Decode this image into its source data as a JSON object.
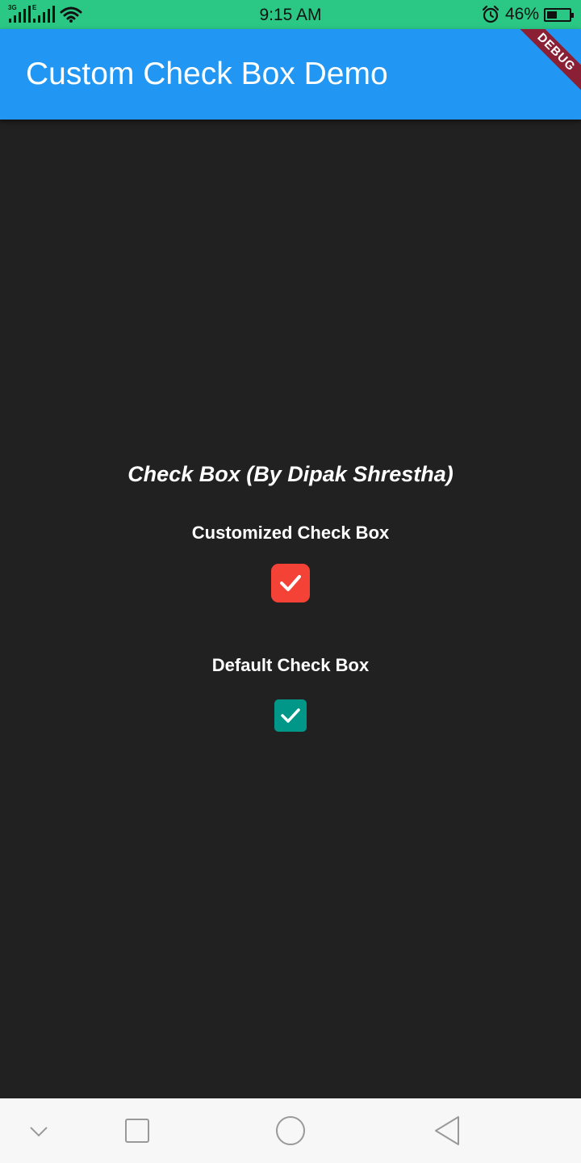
{
  "status_bar": {
    "network_1": "3G",
    "network_2": "E",
    "time": "9:15 AM",
    "battery_percent": "46%",
    "battery_level": 0.46,
    "icons": [
      "signal-icon",
      "wifi-icon",
      "alarm-icon",
      "battery-icon"
    ]
  },
  "app_bar": {
    "title": "Custom Check Box Demo",
    "debug_banner": "DEBUG",
    "color": "#2196f3"
  },
  "main": {
    "heading": "Check Box (By Dipak Shrestha)",
    "custom_checkbox": {
      "label": "Customized Check Box",
      "checked": true,
      "color": "#f44336"
    },
    "default_checkbox": {
      "label": "Default Check Box",
      "checked": true,
      "color": "#009688"
    }
  },
  "nav_bar": {
    "icons": [
      "chevron-down-icon",
      "recents-icon",
      "home-icon",
      "back-icon"
    ]
  },
  "colors": {
    "status_bar": "#2ac785",
    "background": "#212121",
    "nav_bar": "#f7f7f7"
  }
}
